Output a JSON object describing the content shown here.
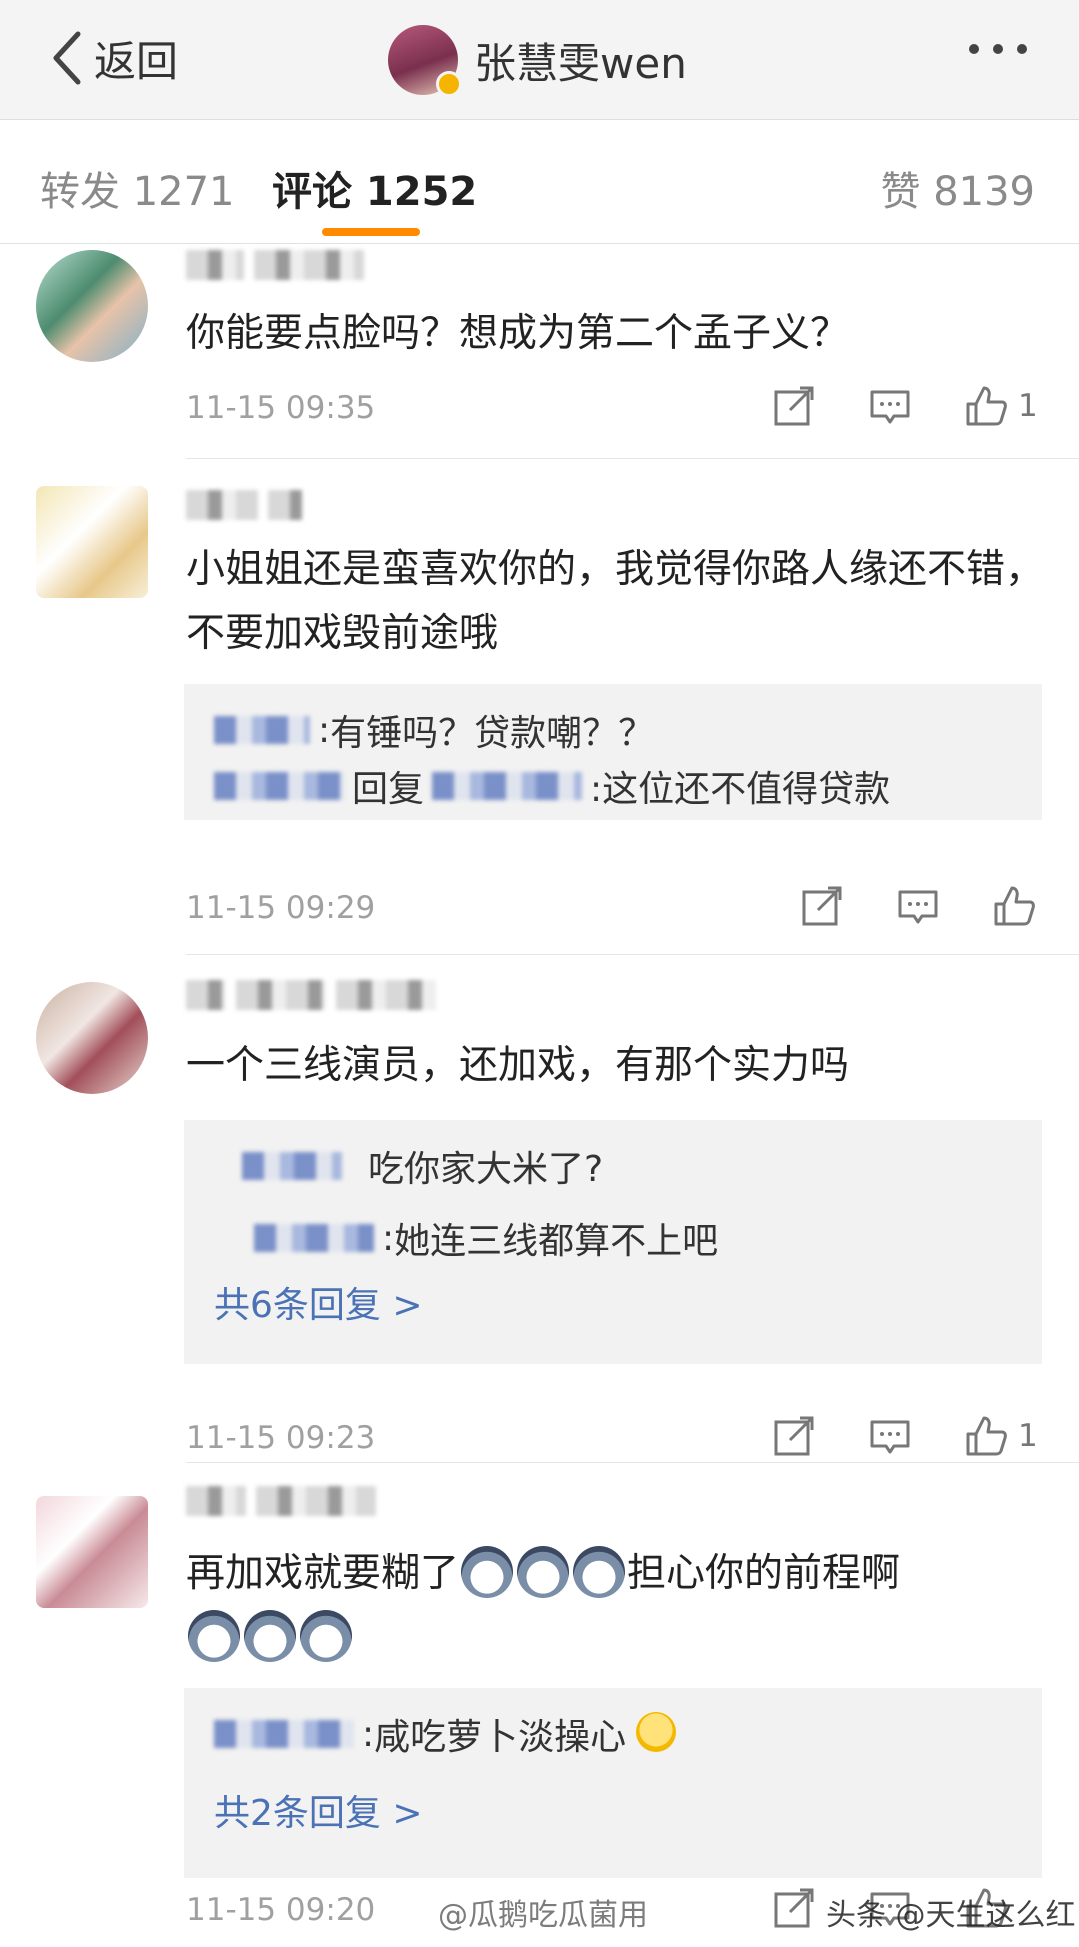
{
  "nav": {
    "back_label": "返回",
    "title": "张慧雯wen"
  },
  "tabs": {
    "repost": "转发 1271",
    "comment": "评论 1252",
    "like": "赞 8139"
  },
  "comments": [
    {
      "text": "你能要点脸吗？想成为第二个孟子义？",
      "time": "11-15 09:35",
      "like_count": "1"
    },
    {
      "text": "小姐姐还是蛮喜欢你的，我觉得你路人缘还不错，不要加戏毁前途哦",
      "replies": [
        {
          "pre": ":",
          "text": " 有锤吗？贷款嘲？？"
        },
        {
          "pre": "回复",
          "text": ":这位还不值得贷款"
        }
      ],
      "time": "11-15 09:29",
      "like_count": ""
    },
    {
      "text": "一个三线演员，还加戏，有那个实力吗",
      "replies": [
        {
          "pre": "",
          "text": "吃你家大米了?"
        },
        {
          "pre": ":",
          "text": " 她连三线都算不上吧"
        }
      ],
      "more_replies": "共6条回复 >",
      "time": "11-15 09:23",
      "like_count": "1"
    },
    {
      "text_a": "再加戏就要糊了",
      "text_b": "担心你的前程啊",
      "replies": [
        {
          "pre": ":",
          "text": " 咸吃萝卜淡操心"
        }
      ],
      "more_replies": "共2条回复 >",
      "time": "11-15 09:20",
      "like_count": ""
    }
  ],
  "watermarks": {
    "left": "@瓜鹅吃瓜菌用",
    "right": "头条 @天生这么红"
  },
  "icons": [
    "back-chevron-icon",
    "more-icon",
    "share-icon",
    "comment-icon",
    "thumb-up-icon",
    "husky-emoji",
    "blush-emoji"
  ],
  "colors": {
    "accent": "#ff8a00",
    "link": "#4a72b5",
    "time": "#a0a0a0"
  }
}
